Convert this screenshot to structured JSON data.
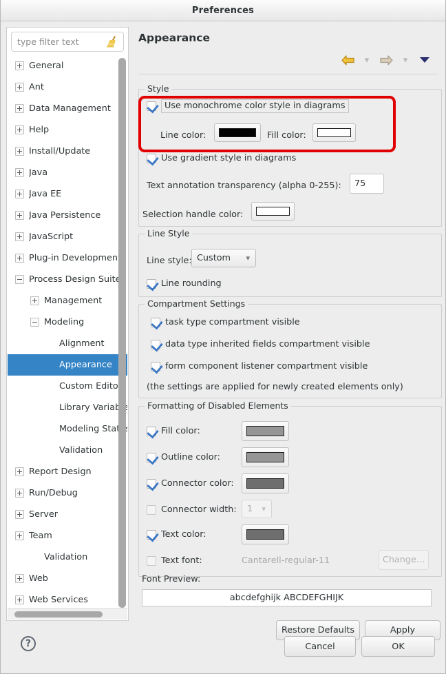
{
  "window": {
    "title": "Preferences"
  },
  "sidebar": {
    "filter": {
      "placeholder": "type filter text",
      "value": "",
      "clear_icon": "broom-icon"
    },
    "items": [
      {
        "label": "General",
        "depth": 1,
        "expander": "plus",
        "selected": false
      },
      {
        "label": "Ant",
        "depth": 1,
        "expander": "plus",
        "selected": false
      },
      {
        "label": "Data Management",
        "depth": 1,
        "expander": "plus",
        "selected": false
      },
      {
        "label": "Help",
        "depth": 1,
        "expander": "plus",
        "selected": false
      },
      {
        "label": "Install/Update",
        "depth": 1,
        "expander": "plus",
        "selected": false
      },
      {
        "label": "Java",
        "depth": 1,
        "expander": "plus",
        "selected": false
      },
      {
        "label": "Java EE",
        "depth": 1,
        "expander": "plus",
        "selected": false
      },
      {
        "label": "Java Persistence",
        "depth": 1,
        "expander": "plus",
        "selected": false
      },
      {
        "label": "JavaScript",
        "depth": 1,
        "expander": "plus",
        "selected": false
      },
      {
        "label": "Plug-in Development",
        "depth": 1,
        "expander": "plus",
        "selected": false
      },
      {
        "label": "Process Design Suite",
        "depth": 1,
        "expander": "minus",
        "selected": false
      },
      {
        "label": "Management",
        "depth": 2,
        "expander": "plus",
        "selected": false
      },
      {
        "label": "Modeling",
        "depth": 2,
        "expander": "minus",
        "selected": false
      },
      {
        "label": "Alignment",
        "depth": 3,
        "expander": "none",
        "selected": false
      },
      {
        "label": "Appearance",
        "depth": 3,
        "expander": "none",
        "selected": true
      },
      {
        "label": "Custom Editors",
        "depth": 3,
        "expander": "none",
        "selected": false
      },
      {
        "label": "Library Variables",
        "depth": 3,
        "expander": "none",
        "selected": false
      },
      {
        "label": "Modeling Status",
        "depth": 3,
        "expander": "none",
        "selected": false
      },
      {
        "label": "Validation",
        "depth": 3,
        "expander": "none",
        "selected": false
      },
      {
        "label": "Report Design",
        "depth": 1,
        "expander": "plus",
        "selected": false
      },
      {
        "label": "Run/Debug",
        "depth": 1,
        "expander": "plus",
        "selected": false
      },
      {
        "label": "Server",
        "depth": 1,
        "expander": "plus",
        "selected": false
      },
      {
        "label": "Team",
        "depth": 1,
        "expander": "plus",
        "selected": false
      },
      {
        "label": "Validation",
        "depth": 2,
        "expander": "none",
        "selected": false
      },
      {
        "label": "Web",
        "depth": 1,
        "expander": "plus",
        "selected": false
      },
      {
        "label": "Web Services",
        "depth": 1,
        "expander": "plus",
        "selected": false
      }
    ]
  },
  "page": {
    "title": "Appearance",
    "nav": {
      "back_icon": "back-arrow-icon",
      "back_menu_icon": "chevron-down-icon",
      "forward_icon": "forward-arrow-icon",
      "forward_menu_icon": "chevron-down-icon",
      "view_menu_icon": "triangle-down-icon"
    }
  },
  "style_group": {
    "legend": "Style",
    "monochrome": {
      "label": "Use monochrome color style in diagrams",
      "checked": true
    },
    "line_color": {
      "label": "Line color:",
      "value": "#000000"
    },
    "fill_color": {
      "label": "Fill color:",
      "value": "#ffffff"
    },
    "gradient": {
      "label": "Use gradient style in diagrams",
      "checked": true
    },
    "transparency": {
      "label": "Text annotation transparency (alpha 0-255):",
      "value": "75"
    },
    "selection_handle": {
      "label": "Selection handle color:",
      "value": "#ffffff"
    }
  },
  "line_style_group": {
    "legend": "Line Style",
    "line_style": {
      "label": "Line style:",
      "value": "Custom",
      "options": [
        "Custom"
      ]
    },
    "line_rounding": {
      "label": "Line rounding",
      "checked": true
    }
  },
  "compartment_group": {
    "legend": "Compartment Settings",
    "items": [
      {
        "label": "task type compartment visible",
        "checked": true
      },
      {
        "label": "data type inherited fields compartment visible",
        "checked": true
      },
      {
        "label": "form component listener compartment visible",
        "checked": true
      }
    ],
    "note": "(the settings are applied for newly created elements only)"
  },
  "disabled_group": {
    "legend": "Formatting of Disabled Elements",
    "rows": [
      {
        "label": "Fill color:",
        "checked": true,
        "swatch": "#969696",
        "kind": "swatch"
      },
      {
        "label": "Outline color:",
        "checked": true,
        "swatch": "#969696",
        "kind": "swatch"
      },
      {
        "label": "Connector color:",
        "checked": true,
        "swatch": "#6e6e6e",
        "kind": "swatch"
      },
      {
        "label": "Connector width:",
        "checked": false,
        "value": "1",
        "kind": "combo",
        "options": [
          "1"
        ]
      },
      {
        "label": "Text color:",
        "checked": true,
        "swatch": "#6e6e6e",
        "kind": "swatch"
      }
    ],
    "text_font": {
      "label": "Text font:",
      "checked": false,
      "value": "Cantarell-regular-11",
      "button": "Change..."
    }
  },
  "font_preview": {
    "label": "Font Preview:",
    "sample": "abcdefghijk ABCDEFGHIJK"
  },
  "buttons": {
    "restore_defaults": "Restore Defaults",
    "apply": "Apply",
    "cancel": "Cancel",
    "ok": "OK",
    "help_icon": "question-mark-icon"
  },
  "annotation": {
    "highlight_color": "#e00000"
  }
}
